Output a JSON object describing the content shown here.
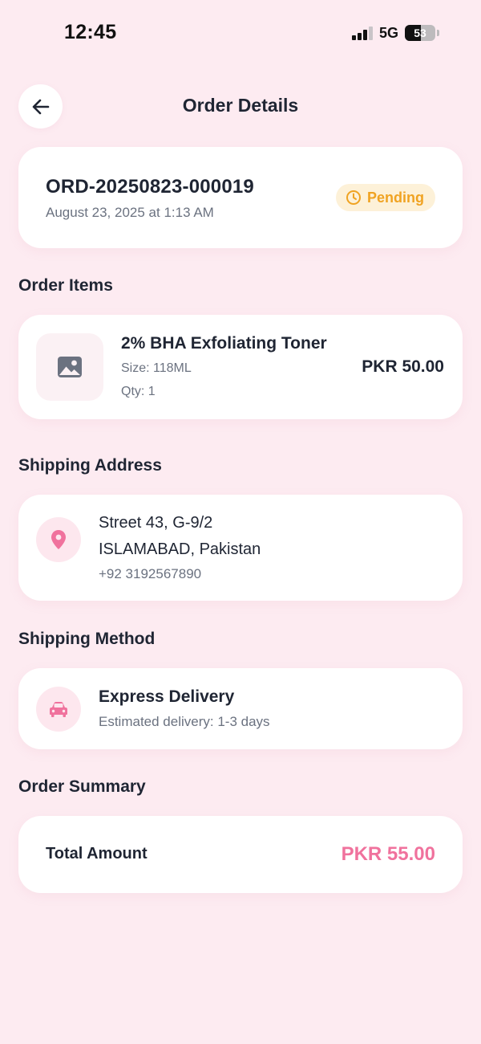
{
  "status_bar": {
    "time": "12:45",
    "network": "5G",
    "battery_level": "53",
    "battery_fraction": 0.53
  },
  "header": {
    "title": "Order Details",
    "back_icon": "arrow-left-icon"
  },
  "order": {
    "number": "ORD-20250823-000019",
    "date": "August 23, 2025 at 1:13 AM",
    "status": "Pending",
    "status_icon": "clock-icon",
    "status_color": "#f0a322",
    "status_bg": "#fdf1d8"
  },
  "sections": {
    "items": "Order Items",
    "shipping_address": "Shipping Address",
    "shipping_method": "Shipping Method",
    "summary": "Order Summary"
  },
  "items": [
    {
      "name": "2% BHA Exfoliating Toner",
      "size": "Size: 118ML",
      "qty": "Qty: 1",
      "price": "PKR 50.00",
      "thumb_icon": "image-placeholder-icon"
    }
  ],
  "address": {
    "line1": "Street 43, G-9/2",
    "line2": "ISLAMABAD, Pakistan",
    "phone": "+92 3192567890",
    "icon": "location-pin-icon"
  },
  "shipping_method": {
    "name": "Express Delivery",
    "eta": "Estimated delivery: 1-3 days",
    "icon": "car-icon"
  },
  "summary": {
    "total_label": "Total Amount",
    "total_value": "PKR 55.00"
  },
  "colors": {
    "background": "#fdebf1",
    "accent": "#f0729d",
    "pending": "#f0a322"
  }
}
